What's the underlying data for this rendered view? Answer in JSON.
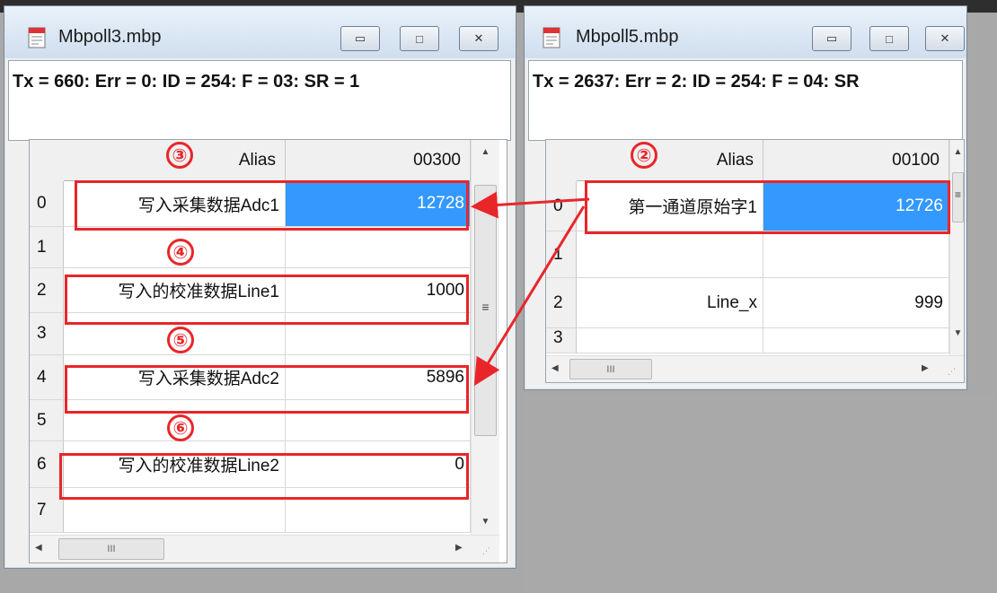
{
  "window_left": {
    "title": "Mbpoll3.mbp",
    "status": "Tx = 660: Err = 0: ID = 254: F = 03: SR = 1",
    "alias_header": "Alias",
    "col_header": "00300",
    "rows": [
      {
        "num": "0",
        "alias": "写入采集数据Adc1",
        "value": "12728"
      },
      {
        "num": "1",
        "alias": "",
        "value": ""
      },
      {
        "num": "2",
        "alias": "写入的校准数据Line1",
        "value": "1000"
      },
      {
        "num": "3",
        "alias": "",
        "value": ""
      },
      {
        "num": "4",
        "alias": "写入采集数据Adc2",
        "value": "5896"
      },
      {
        "num": "5",
        "alias": "",
        "value": ""
      },
      {
        "num": "6",
        "alias": "写入的校准数据Line2",
        "value": "0"
      },
      {
        "num": "7",
        "alias": "",
        "value": ""
      }
    ]
  },
  "window_right": {
    "title": "Mbpoll5.mbp",
    "status": "Tx = 2637: Err = 2: ID = 254: F = 04: SR",
    "alias_header": "Alias",
    "col_header": "00100",
    "rows": [
      {
        "num": "0",
        "alias": "第一通道原始字1",
        "value": "12726"
      },
      {
        "num": "1",
        "alias": "",
        "value": ""
      },
      {
        "num": "2",
        "alias": "Line_x",
        "value": "999"
      },
      {
        "num": "3",
        "alias": "",
        "value": ""
      }
    ]
  },
  "annotations": {
    "n2": "②",
    "n3": "③",
    "n4": "④",
    "n5": "⑤",
    "n6": "⑥"
  },
  "icons": {
    "minimize": "minimize-icon",
    "maximize": "maximize-icon",
    "close": "close-icon",
    "scroll_h_thumb": "III"
  },
  "colors": {
    "selection": "#3399ff",
    "annotation": "#e8262a"
  }
}
